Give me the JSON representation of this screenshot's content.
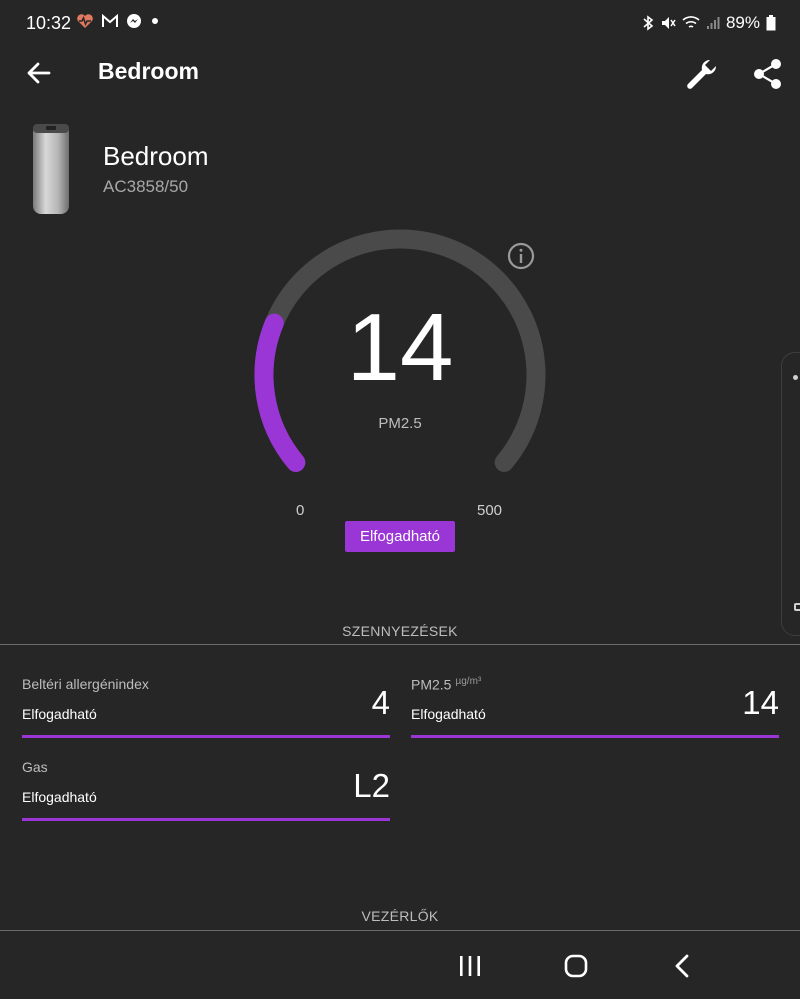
{
  "status_bar": {
    "time": "10:32",
    "battery": "89%",
    "left_icons": [
      "health-icon",
      "gmail-icon",
      "messenger-icon",
      "dot-icon"
    ],
    "right_icons": [
      "bluetooth-icon",
      "mute-icon",
      "wifi-icon",
      "signal-icon",
      "battery-icon"
    ]
  },
  "app_bar": {
    "title": "Bedroom",
    "icons": [
      "back-arrow-icon",
      "wrench-icon",
      "share-icon"
    ]
  },
  "device": {
    "name": "Bedroom",
    "model": "AC3858/50"
  },
  "gauge": {
    "value": "14",
    "label": "PM2.5",
    "min": "0",
    "max": "500",
    "status": "Elfogadható",
    "fill_fraction": 0.028,
    "accent_color": "#9a35d6",
    "track_color": "#4a4a4a"
  },
  "sections": {
    "pollutants": "SZENNYEZÉSEK",
    "controls": "VEZÉRLŐK"
  },
  "metrics": [
    {
      "name": "Beltéri allergénindex",
      "unit": "",
      "status": "Elfogadható",
      "value": "4"
    },
    {
      "name": "PM2.5",
      "unit": "µg/m³",
      "status": "Elfogadható",
      "value": "14"
    },
    {
      "name": "Gas",
      "unit": "",
      "status": "Elfogadható",
      "value": "L2"
    }
  ],
  "nav_bar": {
    "icons": [
      "recent-apps-icon",
      "home-icon",
      "nav-back-icon"
    ]
  }
}
